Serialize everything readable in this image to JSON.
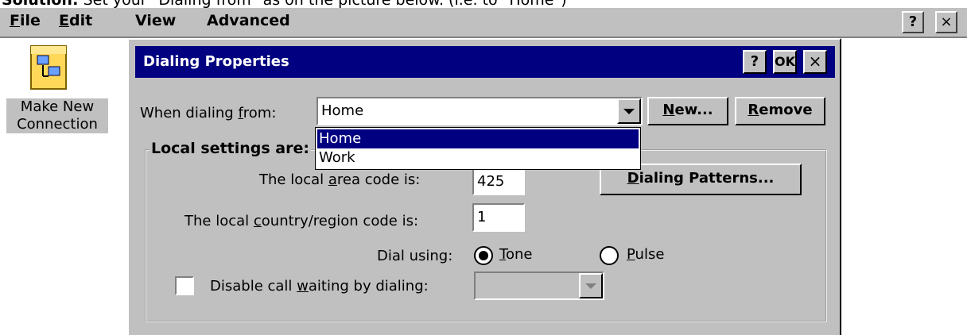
{
  "caption": {
    "bold": "Solution:",
    "text": "Set your \"Dialing from\" as on the picture below. (i.e. to \"Home\")"
  },
  "menubar": {
    "items": [
      "File",
      "Edit",
      "View",
      "Advanced"
    ],
    "help": "?",
    "close": "×"
  },
  "desktop_icon": {
    "label_line1": "Make New",
    "label_line2": "Connection",
    "icon": "network-connection-icon"
  },
  "dialog": {
    "title": "Dialing Properties",
    "help": "?",
    "ok": "OK",
    "close": "×",
    "dialing_from_label": "When dialing from:",
    "dialing_from_value": "Home",
    "new_button": "New...",
    "remove_button": "Remove",
    "dropdown_options": [
      "Home",
      "Work"
    ],
    "dropdown_selected": "Home",
    "group_title": "Local settings are:",
    "area_code_label": "The local area code is:",
    "area_code_value": "425",
    "dialing_patterns_button": "Dialing Patterns...",
    "country_code_label": "The local country/region code is:",
    "country_code_value": "1",
    "dial_using_label": "Dial using:",
    "tone_label": "Tone",
    "pulse_label": "Pulse",
    "dial_mode_selected": "Tone",
    "call_waiting_label": "Disable call waiting by dialing:",
    "call_waiting_checked": false,
    "call_waiting_value": ""
  }
}
